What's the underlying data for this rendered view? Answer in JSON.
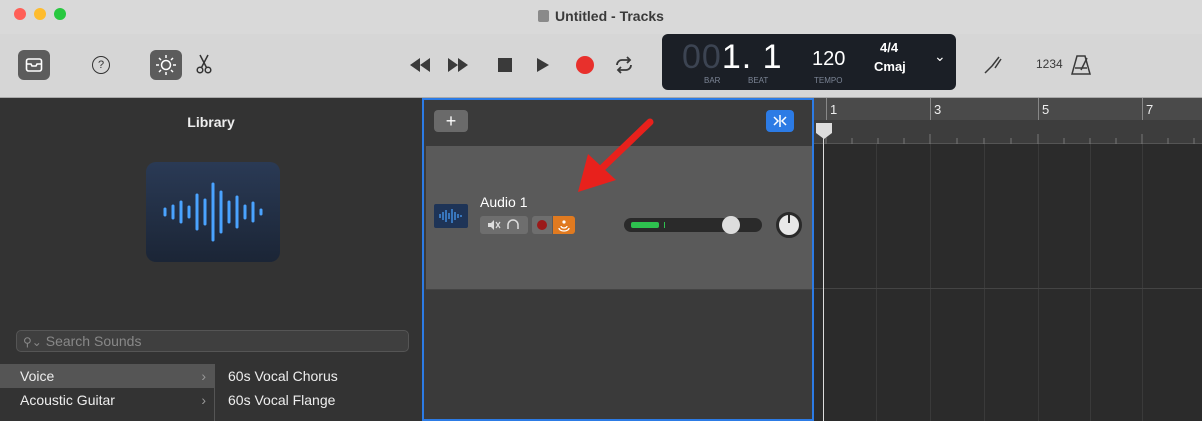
{
  "window": {
    "title": "Untitled - Tracks"
  },
  "lcd": {
    "bar": "00",
    "beat": "1. 1",
    "bar_label": "BAR",
    "beat_label": "BEAT",
    "tempo": "120",
    "tempo_label": "TEMPO",
    "time_sig": "4/4",
    "key": "Cmaj"
  },
  "toolbar": {
    "count_in": "1234"
  },
  "library": {
    "title": "Library",
    "search_placeholder": "Search Sounds",
    "categories": [
      "Voice",
      "Acoustic Guitar"
    ],
    "patches": [
      "60s Vocal Chorus",
      "60s Vocal Flange"
    ]
  },
  "track": {
    "name": "Audio 1",
    "volume": 0.82
  },
  "ruler": {
    "marks": [
      "1",
      "3",
      "5",
      "7"
    ]
  },
  "colors": {
    "record": "#e8302c",
    "accent_blue": "#2c7be5",
    "annotation_arrow": "#e8211c",
    "input_monitor": "#e07a20",
    "volume_green": "#2ec14f"
  }
}
